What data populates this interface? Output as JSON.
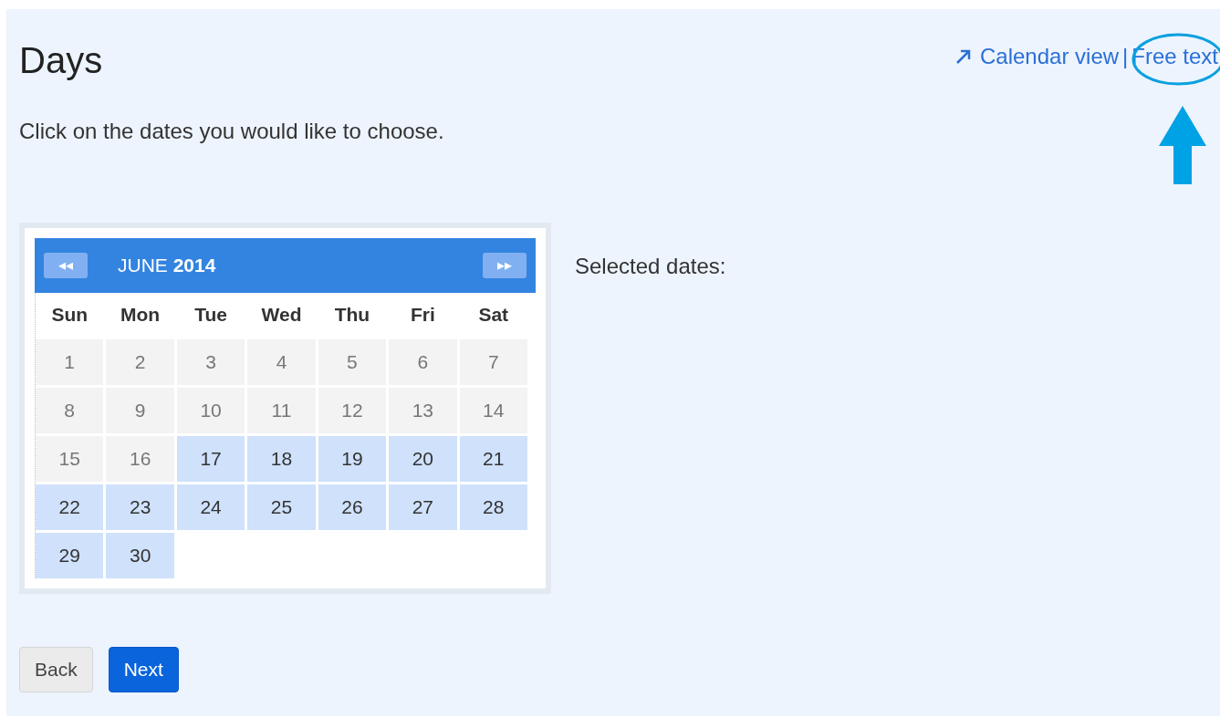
{
  "title": "Days",
  "links": [
    {
      "label": "Calendar view"
    },
    {
      "label": "Free text",
      "highlighted": true
    }
  ],
  "separator": "|",
  "instructions": "Click on the dates you would like to choose.",
  "calendar": {
    "month": "JUNE **2014**",
    "prev": "◂◂",
    "next": "▸▸",
    "weekdays": [
      "Sun",
      "Mon",
      "Tue",
      "Wed",
      "Thu",
      "Fri",
      "Sat"
    ],
    "days": [
      {
        "label": "1",
        "available": false
      },
      {
        "label": "2",
        "available": false
      },
      {
        "label": "3",
        "available": false
      },
      {
        "label": "4",
        "available": false
      },
      {
        "label": "5",
        "available": false
      },
      {
        "label": "6",
        "available": false
      },
      {
        "label": "7",
        "available": false
      },
      {
        "label": "8",
        "available": false
      },
      {
        "label": "9",
        "available": false
      },
      {
        "label": "10",
        "available": false
      },
      {
        "label": "11",
        "available": false
      },
      {
        "label": "12",
        "available": false
      },
      {
        "label": "13",
        "available": false
      },
      {
        "label": "14",
        "available": false
      },
      {
        "label": "15",
        "available": false
      },
      {
        "label": "16",
        "available": false
      },
      {
        "label": "17",
        "available": true
      },
      {
        "label": "18",
        "available": true
      },
      {
        "label": "19",
        "available": true
      },
      {
        "label": "20",
        "available": true
      },
      {
        "label": "21",
        "available": true
      },
      {
        "label": "22",
        "available": true
      },
      {
        "label": "23",
        "available": true
      },
      {
        "label": "24",
        "available": true
      },
      {
        "label": "25",
        "available": true
      },
      {
        "label": "26",
        "available": true
      },
      {
        "label": "27",
        "available": true
      },
      {
        "label": "28",
        "available": true
      },
      {
        "label": "29",
        "available": true
      },
      {
        "label": "30",
        "available": true
      }
    ]
  },
  "selected_dates_label": "Selected dates:",
  "buttons": [
    {
      "label": "Back",
      "kind": "secondary"
    },
    {
      "label": "Next",
      "kind": "primary"
    }
  ]
}
